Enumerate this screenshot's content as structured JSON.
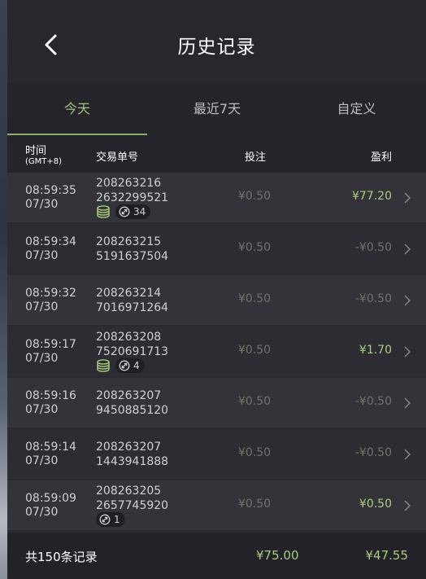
{
  "header": {
    "title": "历史记录"
  },
  "tabs": [
    {
      "label": "今天",
      "active": true
    },
    {
      "label": "最近7天",
      "active": false
    },
    {
      "label": "自定义",
      "active": false
    }
  ],
  "columns": {
    "time": "时间",
    "time_tz": "(GMT+8)",
    "order_no": "交易单号",
    "stake": "投注",
    "profit": "盈利"
  },
  "rows": [
    {
      "time": "08:59:35",
      "date": "07/30",
      "id1": "208263216",
      "id2": "2632299521",
      "stake": "¥0.50",
      "profit": "¥77.20",
      "profit_type": "positive",
      "coin_icon": true,
      "badge": "34"
    },
    {
      "time": "08:59:34",
      "date": "07/30",
      "id1": "208263215",
      "id2": "5191637504",
      "stake": "¥0.50",
      "profit": "-¥0.50",
      "profit_type": "negative",
      "coin_icon": false,
      "badge": null
    },
    {
      "time": "08:59:32",
      "date": "07/30",
      "id1": "208263214",
      "id2": "7016971264",
      "stake": "¥0.50",
      "profit": "-¥0.50",
      "profit_type": "negative",
      "coin_icon": false,
      "badge": null
    },
    {
      "time": "08:59:17",
      "date": "07/30",
      "id1": "208263208",
      "id2": "7520691713",
      "stake": "¥0.50",
      "profit": "¥1.70",
      "profit_type": "positive",
      "coin_icon": true,
      "badge": "4"
    },
    {
      "time": "08:59:16",
      "date": "07/30",
      "id1": "208263207",
      "id2": "9450885120",
      "stake": "¥0.50",
      "profit": "-¥0.50",
      "profit_type": "negative",
      "coin_icon": false,
      "badge": null
    },
    {
      "time": "08:59:14",
      "date": "07/30",
      "id1": "208263207",
      "id2": "1443941888",
      "stake": "¥0.50",
      "profit": "-¥0.50",
      "profit_type": "negative",
      "coin_icon": false,
      "badge": null
    },
    {
      "time": "08:59:09",
      "date": "07/30",
      "id1": "208263205",
      "id2": "2657745920",
      "stake": "¥0.50",
      "profit": "¥0.50",
      "profit_type": "positive",
      "coin_icon": false,
      "badge": "1"
    }
  ],
  "footer": {
    "total_label": "共150条记录",
    "total_stake": "¥75.00",
    "total_profit": "¥47.55"
  },
  "colors": {
    "accent": "#9fc37f",
    "positive": "#a7cf79",
    "muted": "#6e7568",
    "background": "#2b2a31"
  }
}
